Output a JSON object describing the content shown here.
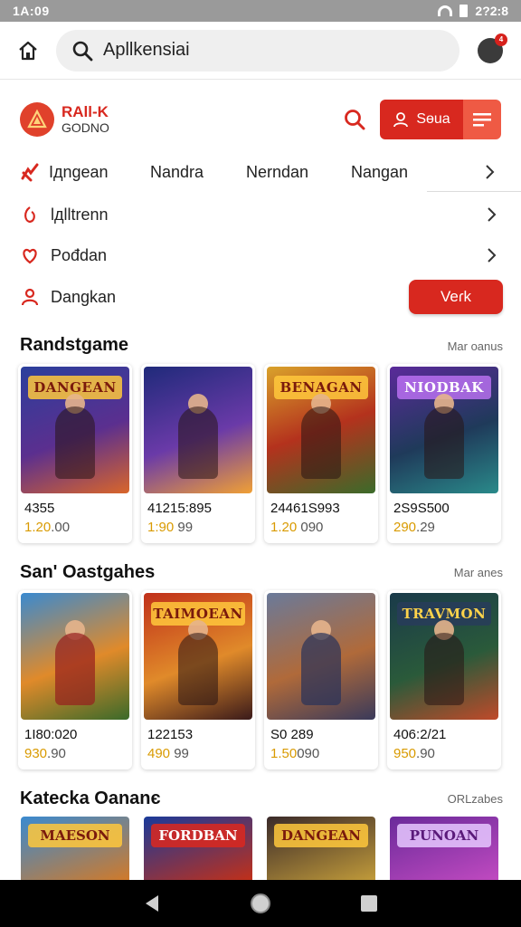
{
  "status_bar": {
    "time": "1А:09",
    "clock_right": "2?2:8"
  },
  "browser": {
    "search_value": "Apllkensiai",
    "avatar_badge": "4"
  },
  "app_header": {
    "brand_line1": "RAll-K",
    "brand_line2": "GODNO",
    "login_label": "Sөuа",
    "accent_color": "#d8281f"
  },
  "nav_tabs": [
    {
      "label": "Iдngean",
      "icon": "flame-icon"
    },
    {
      "label": "Nandra"
    },
    {
      "label": "Nerndan"
    },
    {
      "label": "Nangan"
    }
  ],
  "menu": [
    {
      "label": "lдlltrenn",
      "icon": "tag-icon"
    },
    {
      "label": "Pođdan",
      "icon": "heart-icon"
    },
    {
      "label": "Dangkan",
      "icon": "person-icon"
    }
  ],
  "verify_button": "Veɾk",
  "sections": [
    {
      "title": "Randstgame",
      "more": "Mar oanus",
      "cards": [
        {
          "tag": "DANGEAN",
          "price": "4355",
          "sub_hl": "1.20",
          "sub_rest": ".00"
        },
        {
          "tag": "",
          "price": "41215:895",
          "sub_hl": "1:90",
          "sub_rest": " 99"
        },
        {
          "tag": "BENAGAN",
          "price": "24461S993",
          "sub_hl": "1.20",
          "sub_rest": " 090"
        },
        {
          "tag": "NIODBAK",
          "price": "2S9S500",
          "sub_hl": "290",
          "sub_rest": ".29"
        }
      ]
    },
    {
      "title": "San' Oastgahes",
      "more": "Mar anes",
      "cards": [
        {
          "tag": "",
          "price": "1I80:020",
          "sub_hl": "930",
          "sub_rest": ".90"
        },
        {
          "tag": "TAIMOEAN",
          "price": "122153",
          "sub_hl": "490",
          "sub_rest": " 99"
        },
        {
          "tag": "",
          "price": "S0 289",
          "sub_hl": "1.50",
          "sub_rest": "090"
        },
        {
          "tag": "TRAVMON",
          "price": "406:2/21",
          "sub_hl": "950",
          "sub_rest": ".90"
        }
      ]
    },
    {
      "title": "Katecka Oananє",
      "more": "ORLzabes",
      "cards": [
        {
          "tag": "MAESON"
        },
        {
          "tag": "FORDBAN"
        },
        {
          "tag": "DANGEAN"
        },
        {
          "tag": "PUNOAN"
        }
      ]
    }
  ]
}
